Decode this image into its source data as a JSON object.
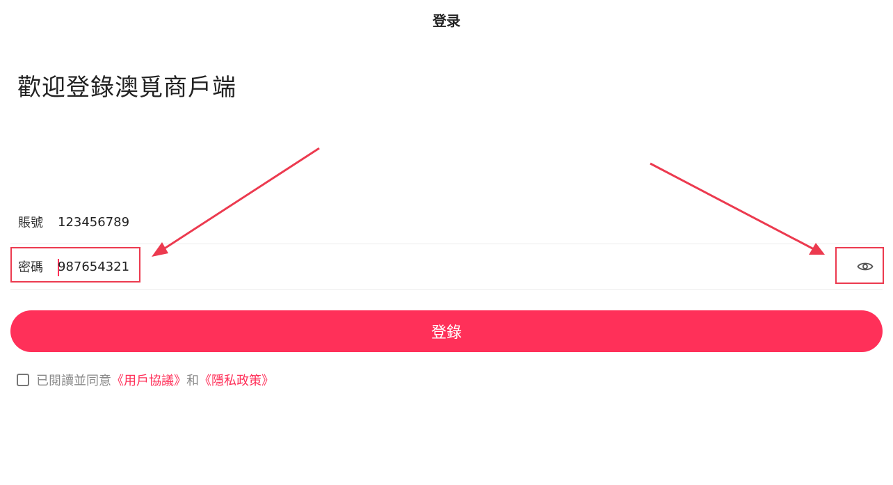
{
  "header": {
    "title": "登录"
  },
  "welcome_text": "歡迎登錄澳覓商戶端",
  "account": {
    "label": "賬號",
    "value": "123456789"
  },
  "password": {
    "label": "密碼",
    "value": "987654321",
    "toggle_icon": "eye-icon"
  },
  "login_button": {
    "label": "登錄"
  },
  "agreement": {
    "prefix": "已閱讀並同意",
    "user_agreement": "《用戶協議》",
    "conjunction": "和",
    "privacy_policy": "《隱私政策》",
    "checked": false
  },
  "colors": {
    "accent": "#ff3059",
    "annotation": "#ec3a4f"
  }
}
